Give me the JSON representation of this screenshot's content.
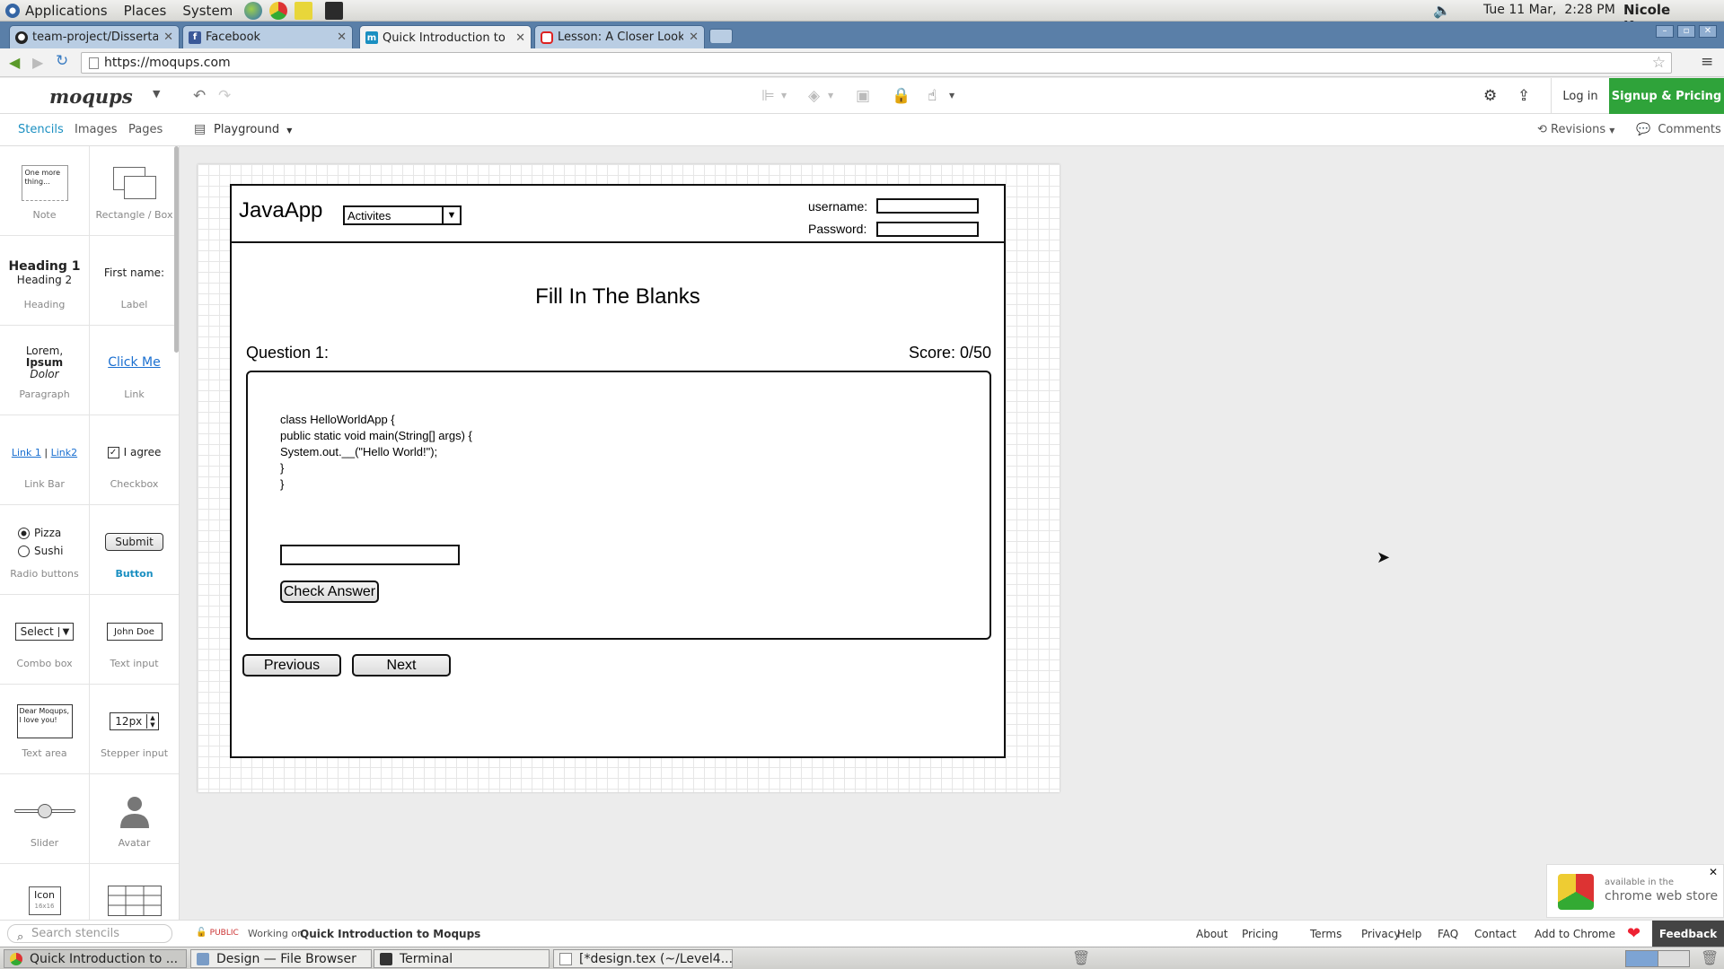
{
  "gnome_panel": {
    "menus": [
      "Applications",
      "Places",
      "System"
    ],
    "datetime": "Tue 11 Mar,  2:28 PM",
    "user": "Nicole Kearns"
  },
  "browser": {
    "tabs": [
      {
        "title": "team-project/Dissertatic",
        "icon": "github-icon"
      },
      {
        "title": "Facebook",
        "icon": "facebook-icon"
      },
      {
        "title": "Quick Introduction to M",
        "icon": "moqups-icon"
      },
      {
        "title": "Lesson: A Closer Look a",
        "icon": "oracle-icon"
      }
    ],
    "url": "https://moqups.com"
  },
  "app": {
    "logo": "moqups",
    "login": "Log in",
    "signup": "Signup & Pricing",
    "side_tabs": [
      "Stencils",
      "Images",
      "Pages"
    ],
    "page_selector": "Playground",
    "revisions": "Revisions",
    "comments": "Comments"
  },
  "stencils": {
    "items": [
      {
        "label": "Note",
        "preview": "One more thing..."
      },
      {
        "label": "Rectangle / Box"
      },
      {
        "label": "Heading",
        "preview_h1": "Heading 1",
        "preview_h2": "Heading 2"
      },
      {
        "label": "Label",
        "preview": "First name:"
      },
      {
        "label": "Paragraph",
        "preview_lines": [
          "Lorem,",
          "Ipsum",
          "Dolor"
        ]
      },
      {
        "label": "Link",
        "preview": "Click Me"
      },
      {
        "label": "Link Bar",
        "preview_links": [
          "Link 1",
          "Link2"
        ]
      },
      {
        "label": "Checkbox",
        "preview": "I agree"
      },
      {
        "label": "Radio buttons",
        "preview_options": [
          "Pizza",
          "Sushi"
        ]
      },
      {
        "label": "Button",
        "preview": "Submit"
      },
      {
        "label": "Combo box",
        "preview": "Select"
      },
      {
        "label": "Text input",
        "preview": "John Doe"
      },
      {
        "label": "Text area",
        "preview": "Dear Moqups, I love you!"
      },
      {
        "label": "Stepper input",
        "preview": "12px"
      },
      {
        "label": "Slider"
      },
      {
        "label": "Avatar"
      },
      {
        "label": "",
        "preview": "Icon",
        "preview_sub": "16x16"
      },
      {
        "label": ""
      }
    ],
    "search_placeholder": "Search stencils"
  },
  "mockup": {
    "app_title": "JavaApp",
    "dropdown_value": "Activites",
    "username_label": "username:",
    "password_label": "Password:",
    "page_heading": "Fill In The Blanks",
    "question_label": "Question 1:",
    "score_label": "Score: 0/50",
    "code_lines": [
      "class HelloWorldApp {",
      "public static void main(String[] args) {",
      "System.out.__(\"Hello World!\");",
      "}",
      "}"
    ],
    "check_button": "Check Answer",
    "previous_button": "Previous",
    "next_button": "Next"
  },
  "footer": {
    "visibility": "PUBLIC",
    "working_on_prefix": "Working on",
    "project_name": "Quick Introduction to Moqups",
    "links": [
      "About",
      "Pricing",
      "Terms",
      "Privacy",
      "Help",
      "FAQ",
      "Contact",
      "Add to Chrome"
    ],
    "feedback": "Feedback"
  },
  "cws_promo": {
    "line1": "available in the",
    "line2": "chrome web store"
  },
  "taskbar": {
    "tasks": [
      "Quick Introduction to ...",
      "Design — File Browser",
      "Terminal",
      "[*design.tex (~/Level4..."
    ]
  },
  "colors": {
    "accent": "#1a8fc1",
    "signup_green": "#2fa33a",
    "tab_strip": "#5a7fa8"
  }
}
